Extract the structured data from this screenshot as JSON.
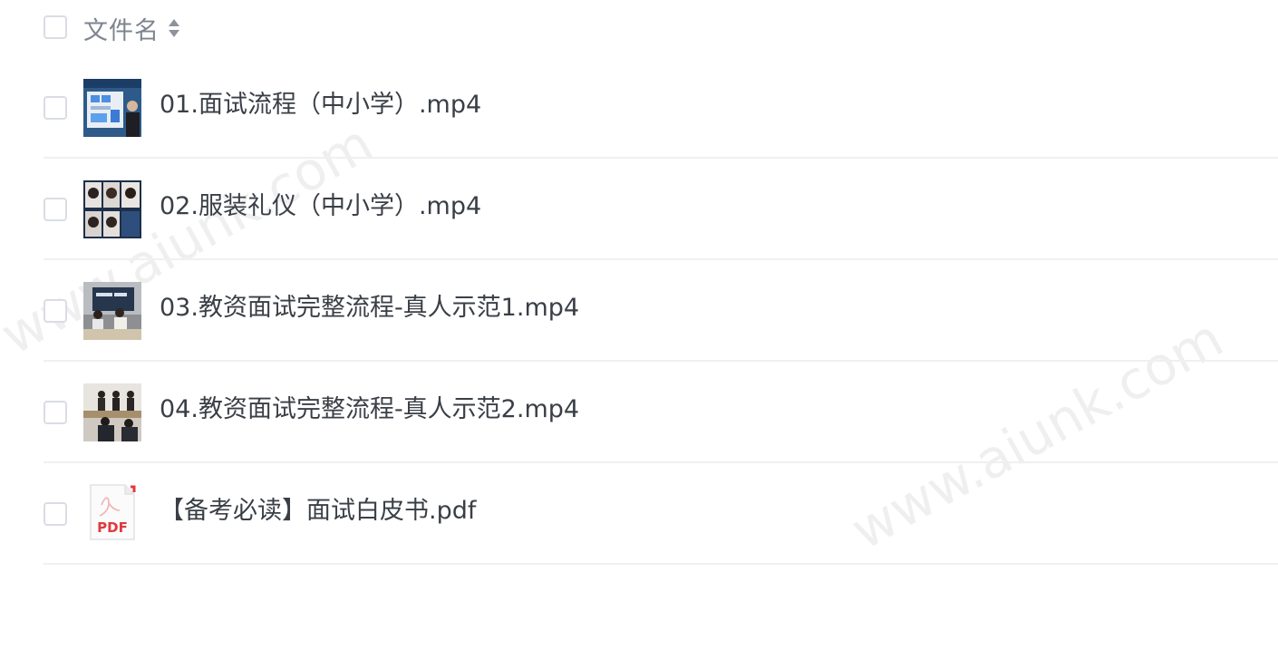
{
  "header": {
    "title": "文件名"
  },
  "files": [
    {
      "name": "01.面试流程（中小学）.mp4",
      "type": "video",
      "thumb": "presentation-slides"
    },
    {
      "name": "02.服装礼仪（中小学）.mp4",
      "type": "video",
      "thumb": "portrait-grid"
    },
    {
      "name": "03.教资面试完整流程-真人示范1.mp4",
      "type": "video",
      "thumb": "classroom-screen"
    },
    {
      "name": "04.教资面试完整流程-真人示范2.mp4",
      "type": "video",
      "thumb": "classroom-panel"
    },
    {
      "name": "【备考必读】面试白皮书.pdf",
      "type": "pdf",
      "icon_label": "PDF"
    }
  ],
  "watermark": {
    "text": "www.aiunk.com"
  },
  "colors": {
    "text": "#3a3f46",
    "header_text": "#7e858f",
    "border": "#d9dde3",
    "divider": "#eef0f3",
    "pdf_red": "#e0393e"
  }
}
